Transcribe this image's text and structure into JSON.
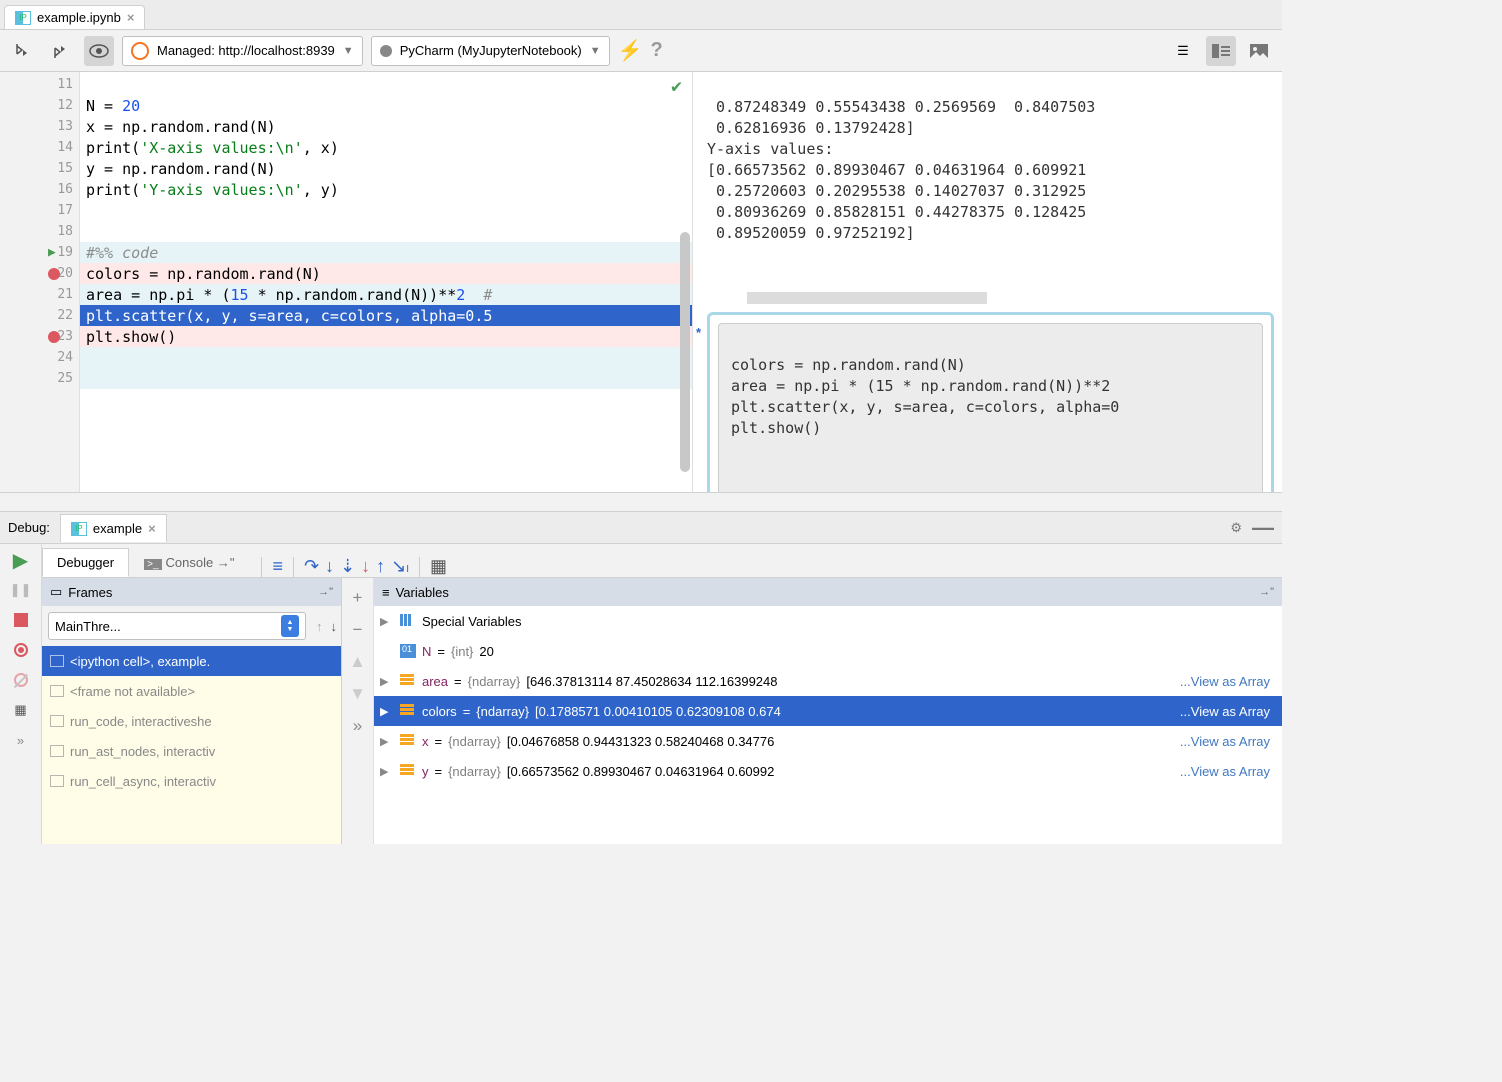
{
  "tab": {
    "filename": "example.ipynb"
  },
  "toolbar": {
    "server": "Managed: http://localhost:8939",
    "kernel": "PyCharm (MyJupyterNotebook)"
  },
  "gutter_lines": [
    "11",
    "12",
    "13",
    "14",
    "15",
    "16",
    "17",
    "18",
    "19",
    "20",
    "21",
    "22",
    "23",
    "24",
    "25"
  ],
  "code": {
    "l12_a": "N = ",
    "l12_b": "20",
    "l13": "x = np.random.rand(N)",
    "l14_a": "print(",
    "l14_b": "'X-axis values:\\n'",
    "l14_c": ", x)",
    "l15": "y = np.random.rand(N)",
    "l16_a": "print(",
    "l16_b": "'Y-axis values:\\n'",
    "l16_c": ", y)",
    "l19": "#%% code",
    "l20": "colors = np.random.rand(N)",
    "l21_a": "area = np.pi * (",
    "l21_b": "15",
    "l21_c": " * np.random.rand(N))**",
    "l21_d": "2",
    "l21_e": "  #",
    "l22": "plt.scatter(x, y, s=area, c=colors, alpha=0.5",
    "l23": "plt.show()"
  },
  "output": {
    "line1": " 0.87248349 0.55543438 0.2569569  0.8407503",
    "line2": " 0.62816936 0.13792428]",
    "line3": "Y-axis values:",
    "line4": "[0.66573562 0.89930467 0.04631964 0.609921",
    "line5": " 0.25720603 0.20295538 0.14027037 0.312925",
    "line6": " 0.80936269 0.85828151 0.44278375 0.128425",
    "line7": " 0.89520059 0.97252192]",
    "cell1": "colors = np.random.rand(N)",
    "cell2": "area = np.pi * (15 * np.random.rand(N))**2",
    "cell3": "plt.scatter(x, y, s=area, c=colors, alpha=0",
    "cell4": "plt.show()"
  },
  "debug": {
    "label": "Debug:",
    "runconfig": "example",
    "tab_debugger": "Debugger",
    "tab_console": "Console",
    "frames_title": "Frames",
    "vars_title": "Variables",
    "thread": "MainThre...",
    "frames": [
      "<ipython cell>, example.",
      "<frame not available>",
      "run_code, interactiveshe",
      "run_ast_nodes, interactiv",
      "run_cell_async, interactiv"
    ],
    "vars": {
      "special": "Special Variables",
      "N": {
        "name": "N",
        "type": "{int}",
        "value": "20"
      },
      "area": {
        "name": "area",
        "type": "{ndarray}",
        "value": "[646.37813114  87.45028634 112.16399248",
        "link": "...View as Array"
      },
      "colors": {
        "name": "colors",
        "type": "{ndarray}",
        "value": "[0.1788571  0.00410105 0.62309108 0.674",
        "link": "...View as Array"
      },
      "x": {
        "name": "x",
        "type": "{ndarray}",
        "value": "[0.04676858 0.94431323 0.58240468 0.34776",
        "link": "...View as Array"
      },
      "y": {
        "name": "y",
        "type": "{ndarray}",
        "value": "[0.66573562 0.89930467 0.04631964 0.60992",
        "link": "...View as Array"
      }
    }
  }
}
